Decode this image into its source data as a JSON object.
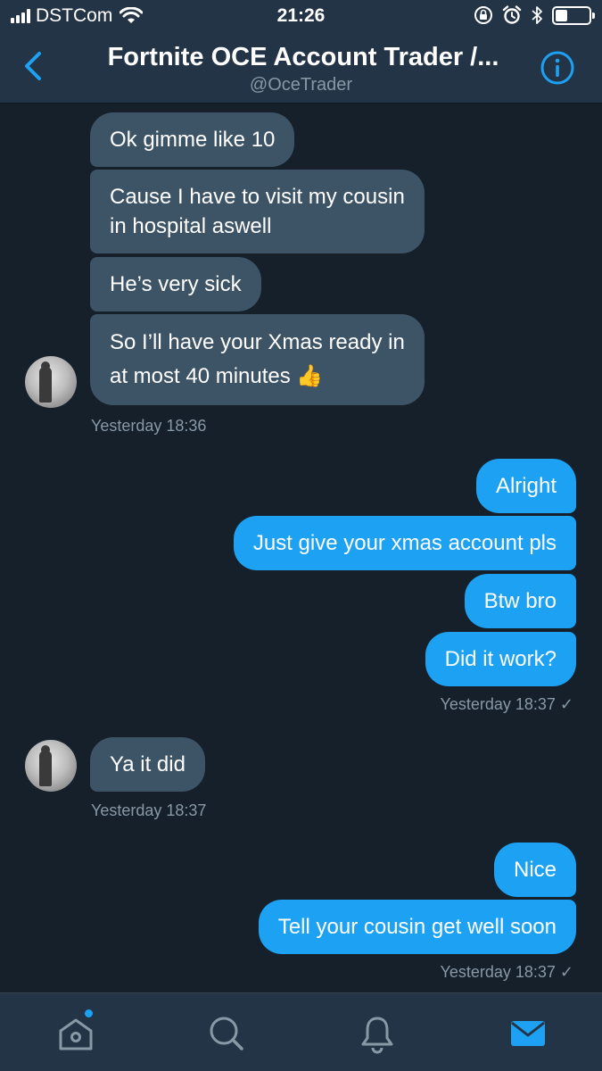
{
  "status_bar": {
    "carrier": "DSTCom",
    "time": "21:26"
  },
  "header": {
    "title": "Fortnite OCE Account Trader /...",
    "handle": "@OceTrader"
  },
  "messages": [
    {
      "text": "Ok gimme like 10"
    },
    {
      "text_line1": "Cause I have to visit my cousin",
      "text_line2": "in hospital aswell"
    },
    {
      "text": "He’s very sick"
    },
    {
      "text_line1": "So I’ll have your Xmas ready in",
      "text_line2": "at most 40 minutes 👍"
    },
    {
      "text": "Alright"
    },
    {
      "text": "Just give your xmas account pls"
    },
    {
      "text": "Btw bro"
    },
    {
      "text": "Did it work?"
    },
    {
      "text": "Ya it did"
    },
    {
      "text": "Nice"
    },
    {
      "text": "Tell your cousin get well soon"
    }
  ],
  "timestamps": [
    "Yesterday 18:36",
    "Yesterday 18:37 ✓",
    "Yesterday 18:37",
    "Yesterday 18:37 ✓"
  ],
  "colors": {
    "background": "#15202b",
    "bar": "#243447",
    "incoming_bubble": "#3d5466",
    "outgoing_bubble": "#1da1f2",
    "accent": "#1da1f2",
    "muted_text": "#8899a6"
  },
  "tabs": [
    {
      "icon": "home-icon"
    },
    {
      "icon": "search-icon"
    },
    {
      "icon": "bell-icon"
    },
    {
      "icon": "mail-icon",
      "active": true
    }
  ]
}
